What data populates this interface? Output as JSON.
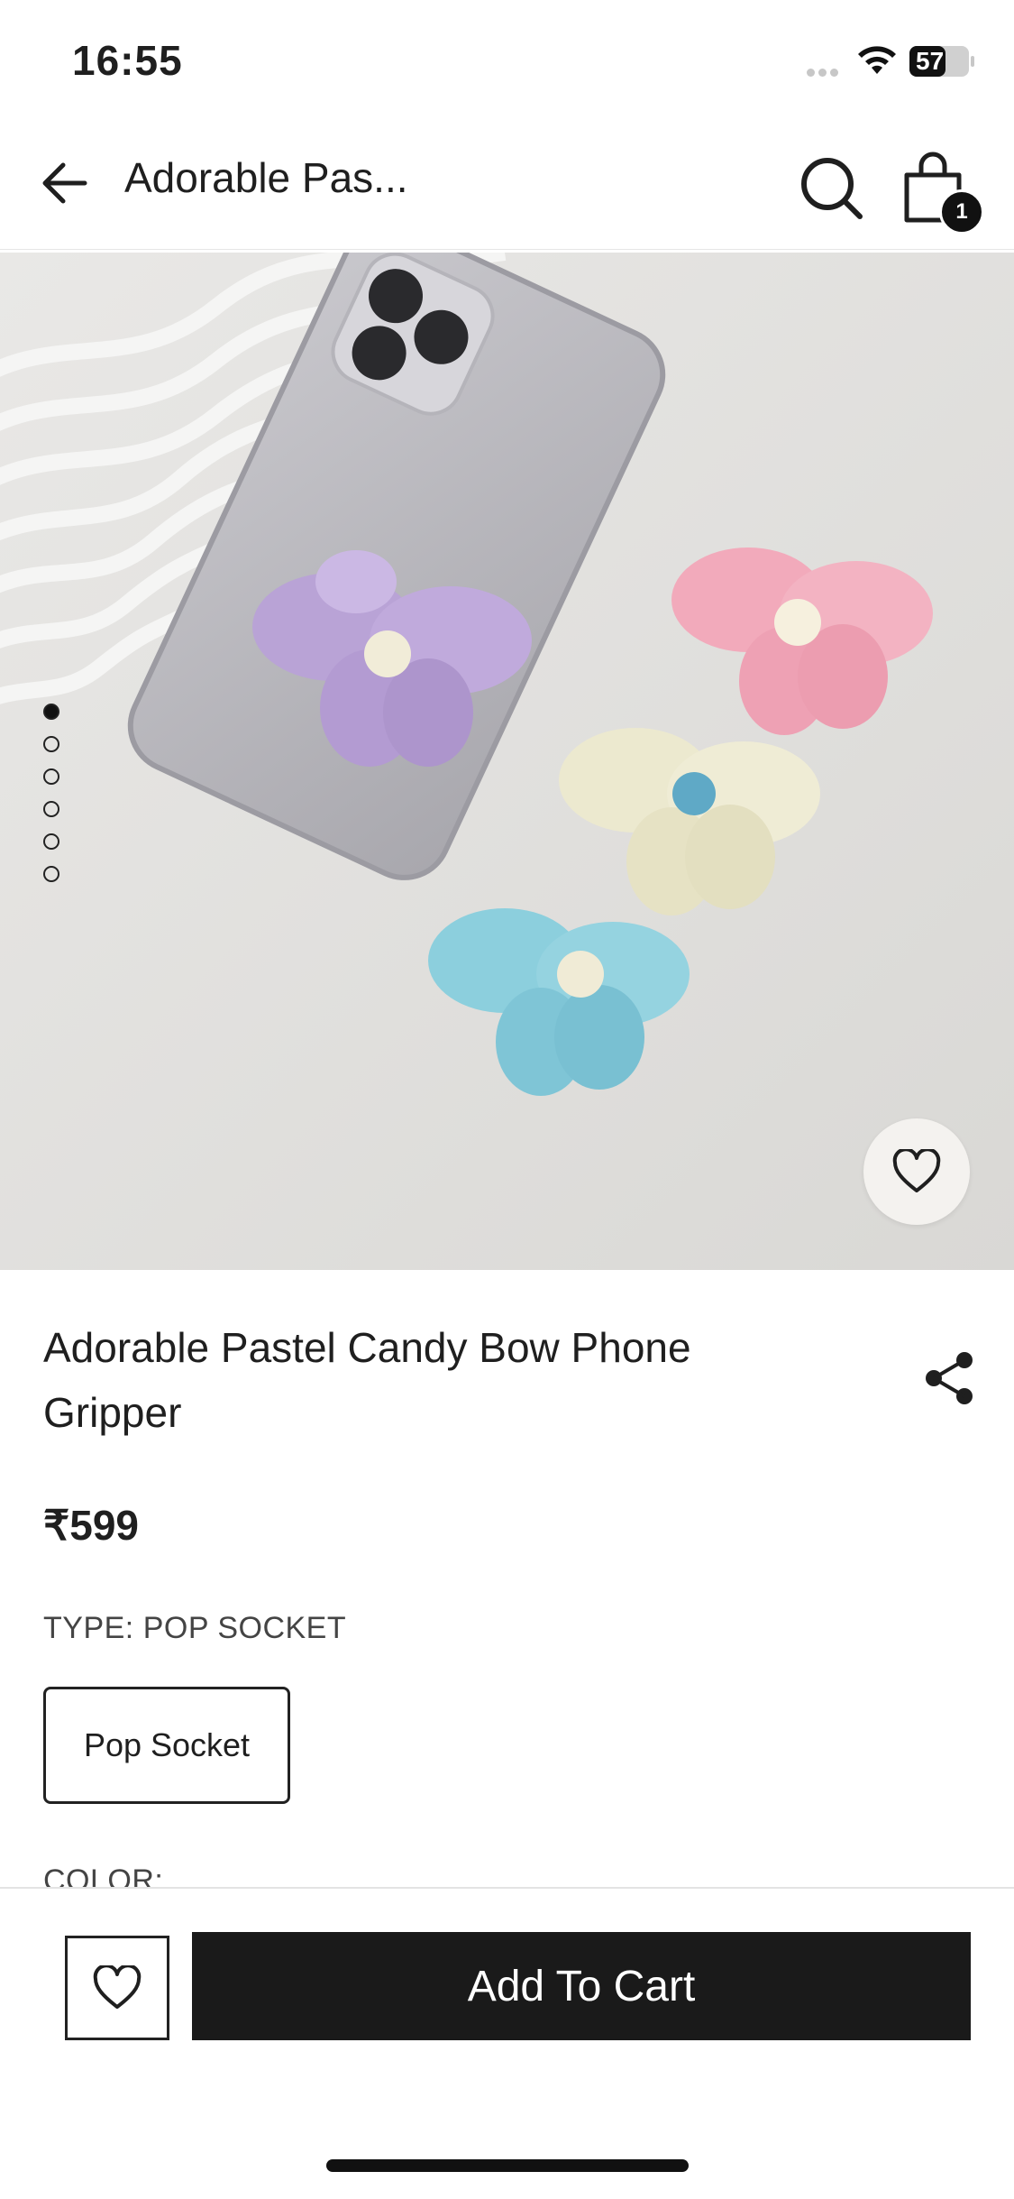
{
  "status_bar": {
    "time": "16:55",
    "battery": "57"
  },
  "nav": {
    "title": "Adorable Pas...",
    "cart_count": "1"
  },
  "carousel": {
    "total_images": 6,
    "active_index": 0
  },
  "product": {
    "title": "Adorable Pastel Candy Bow Phone Gripper",
    "price": "₹599",
    "type_label": "TYPE: POP SOCKET",
    "variant": "Pop Socket",
    "color_label": "COLOR:"
  },
  "actions": {
    "add_to_cart": "Add To Cart"
  },
  "icons": [
    "back-arrow-icon",
    "search-icon",
    "shopping-bag-icon",
    "heart-icon",
    "share-icon",
    "wifi-icon",
    "battery-icon"
  ]
}
